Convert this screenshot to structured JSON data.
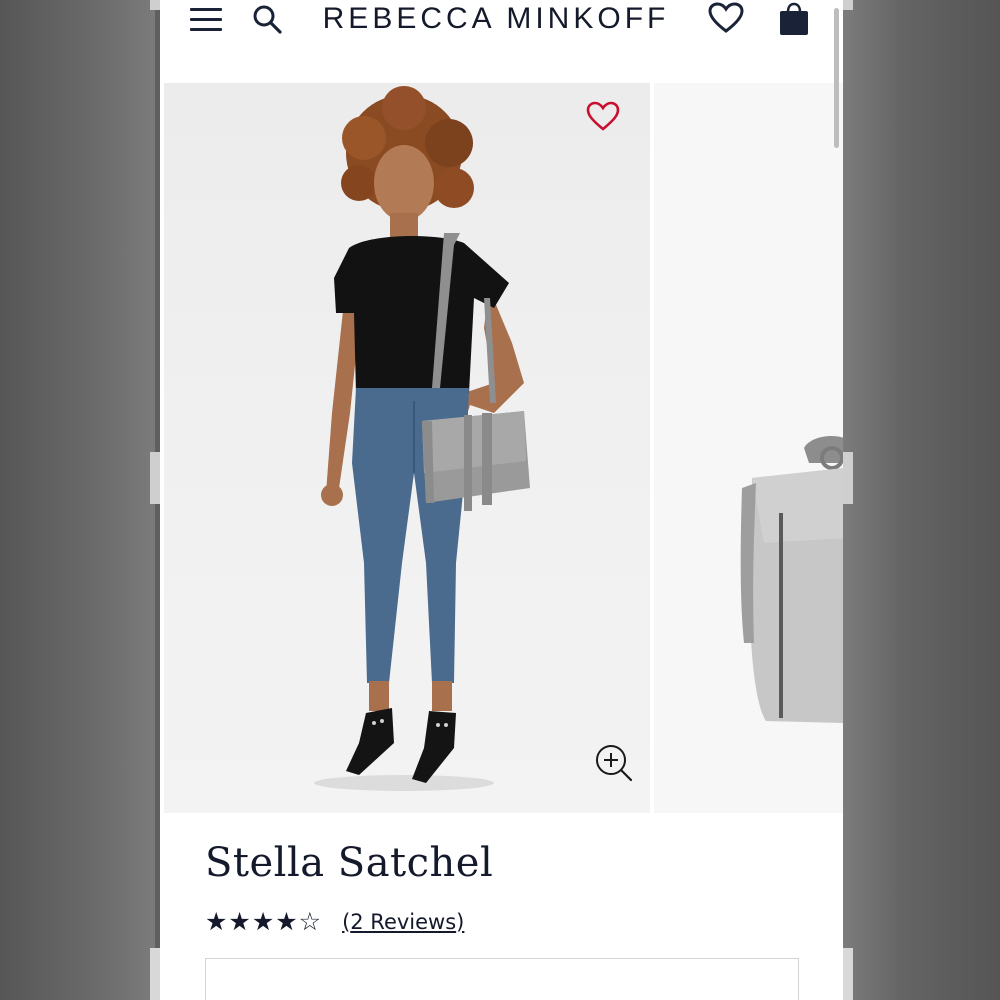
{
  "header": {
    "brand": "REBECCA MINKOFF",
    "icons": [
      "menu-icon",
      "search-icon",
      "heart-icon",
      "bag-icon"
    ]
  },
  "gallery": {
    "icons": [
      "wishlist-heart-icon",
      "zoom-in-icon"
    ],
    "colors": {
      "heart": "#c8102e",
      "bag": "#9c9c9c",
      "top": "#111111",
      "jeans": "#4a6a8e"
    }
  },
  "product": {
    "title": "Stella Satchel",
    "rating": 4,
    "rating_max": 5,
    "stars": "★★★★☆",
    "reviews_open": "(",
    "reviews_label": "2 Reviews",
    "reviews_close": ")"
  },
  "colors": {
    "navy": "#141a2b",
    "background": "#ffffff"
  }
}
